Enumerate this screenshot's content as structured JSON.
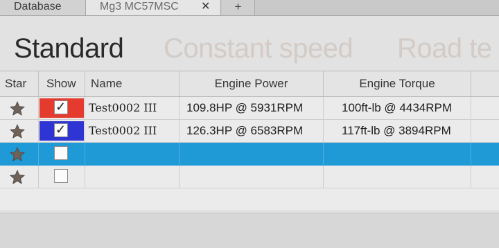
{
  "tabs": {
    "database": "Database",
    "active": "Mg3 MC57MSC",
    "close": "✕",
    "add": "+"
  },
  "modes": [
    "Standard",
    "Constant speed",
    "Road te"
  ],
  "columns": {
    "star": "Star",
    "show": "Show",
    "name": "Name",
    "power": "Engine Power",
    "torque": "Engine Torque"
  },
  "rows": [
    {
      "star": "star-icon",
      "color": "#e53a2e",
      "checked": "✓",
      "name": "Test0002 III",
      "power": "109.8HP @  5931RPM",
      "torque": "100ft-lb @ 4434RPM"
    },
    {
      "star": "star-icon",
      "color": "#2f35d2",
      "checked": "✓",
      "name": "Test0002 III",
      "power": "126.3HP @  6583RPM",
      "torque": "117ft-lb @ 3894RPM"
    },
    {
      "star": "star-icon",
      "color": "",
      "checked": "",
      "name": "",
      "power": "",
      "torque": "",
      "selected": true
    },
    {
      "star": "star-icon",
      "color": "",
      "checked": "",
      "name": "",
      "power": "",
      "torque": ""
    }
  ],
  "colors": {
    "selection": "#1f9ad6",
    "star": "#6e6259"
  }
}
